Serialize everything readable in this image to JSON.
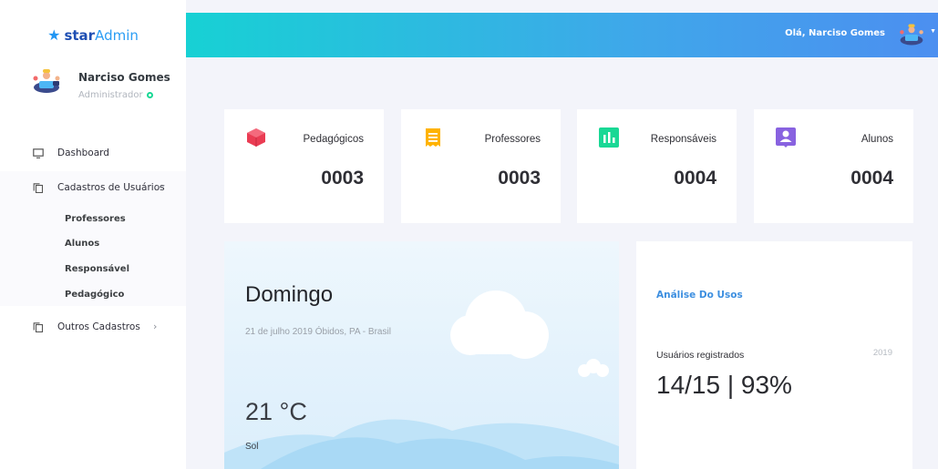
{
  "brand": {
    "icon": "star-icon",
    "bold": "star",
    "light": "Admin"
  },
  "profile": {
    "name": "Narciso Gomes",
    "role": "Administrador"
  },
  "sidebar": {
    "items": [
      {
        "label": "Dashboard",
        "icon": "monitor-icon"
      },
      {
        "label": "Cadastros de Usuários",
        "icon": "copy-icon"
      },
      {
        "label": "Outros Cadastros",
        "icon": "copy-icon"
      }
    ],
    "submenu": [
      "Professores",
      "Alunos",
      "Responsável",
      "Pedagógico"
    ]
  },
  "header": {
    "greeting": "Olá, Narciso Gomes"
  },
  "stats": [
    {
      "label": "Pedagógicos",
      "value": "0003",
      "icon": "cube-icon",
      "color": "#ea3c53"
    },
    {
      "label": "Professores",
      "value": "0003",
      "icon": "receipt-icon",
      "color": "#ffb300"
    },
    {
      "label": "Responsáveis",
      "value": "0004",
      "icon": "bar-chart-icon",
      "color": "#19d895"
    },
    {
      "label": "Alunos",
      "value": "0004",
      "icon": "account-box-icon",
      "color": "#8862e0"
    }
  ],
  "weather": {
    "day": "Domingo",
    "date": "21 de julho 2019 Óbidos, PA - Brasil",
    "temperature": "21 °C",
    "condition": "Sol"
  },
  "usage": {
    "title": "Análise Do Usos",
    "label": "Usuários registrados",
    "year": "2019",
    "value": "14/15 | 93%"
  }
}
